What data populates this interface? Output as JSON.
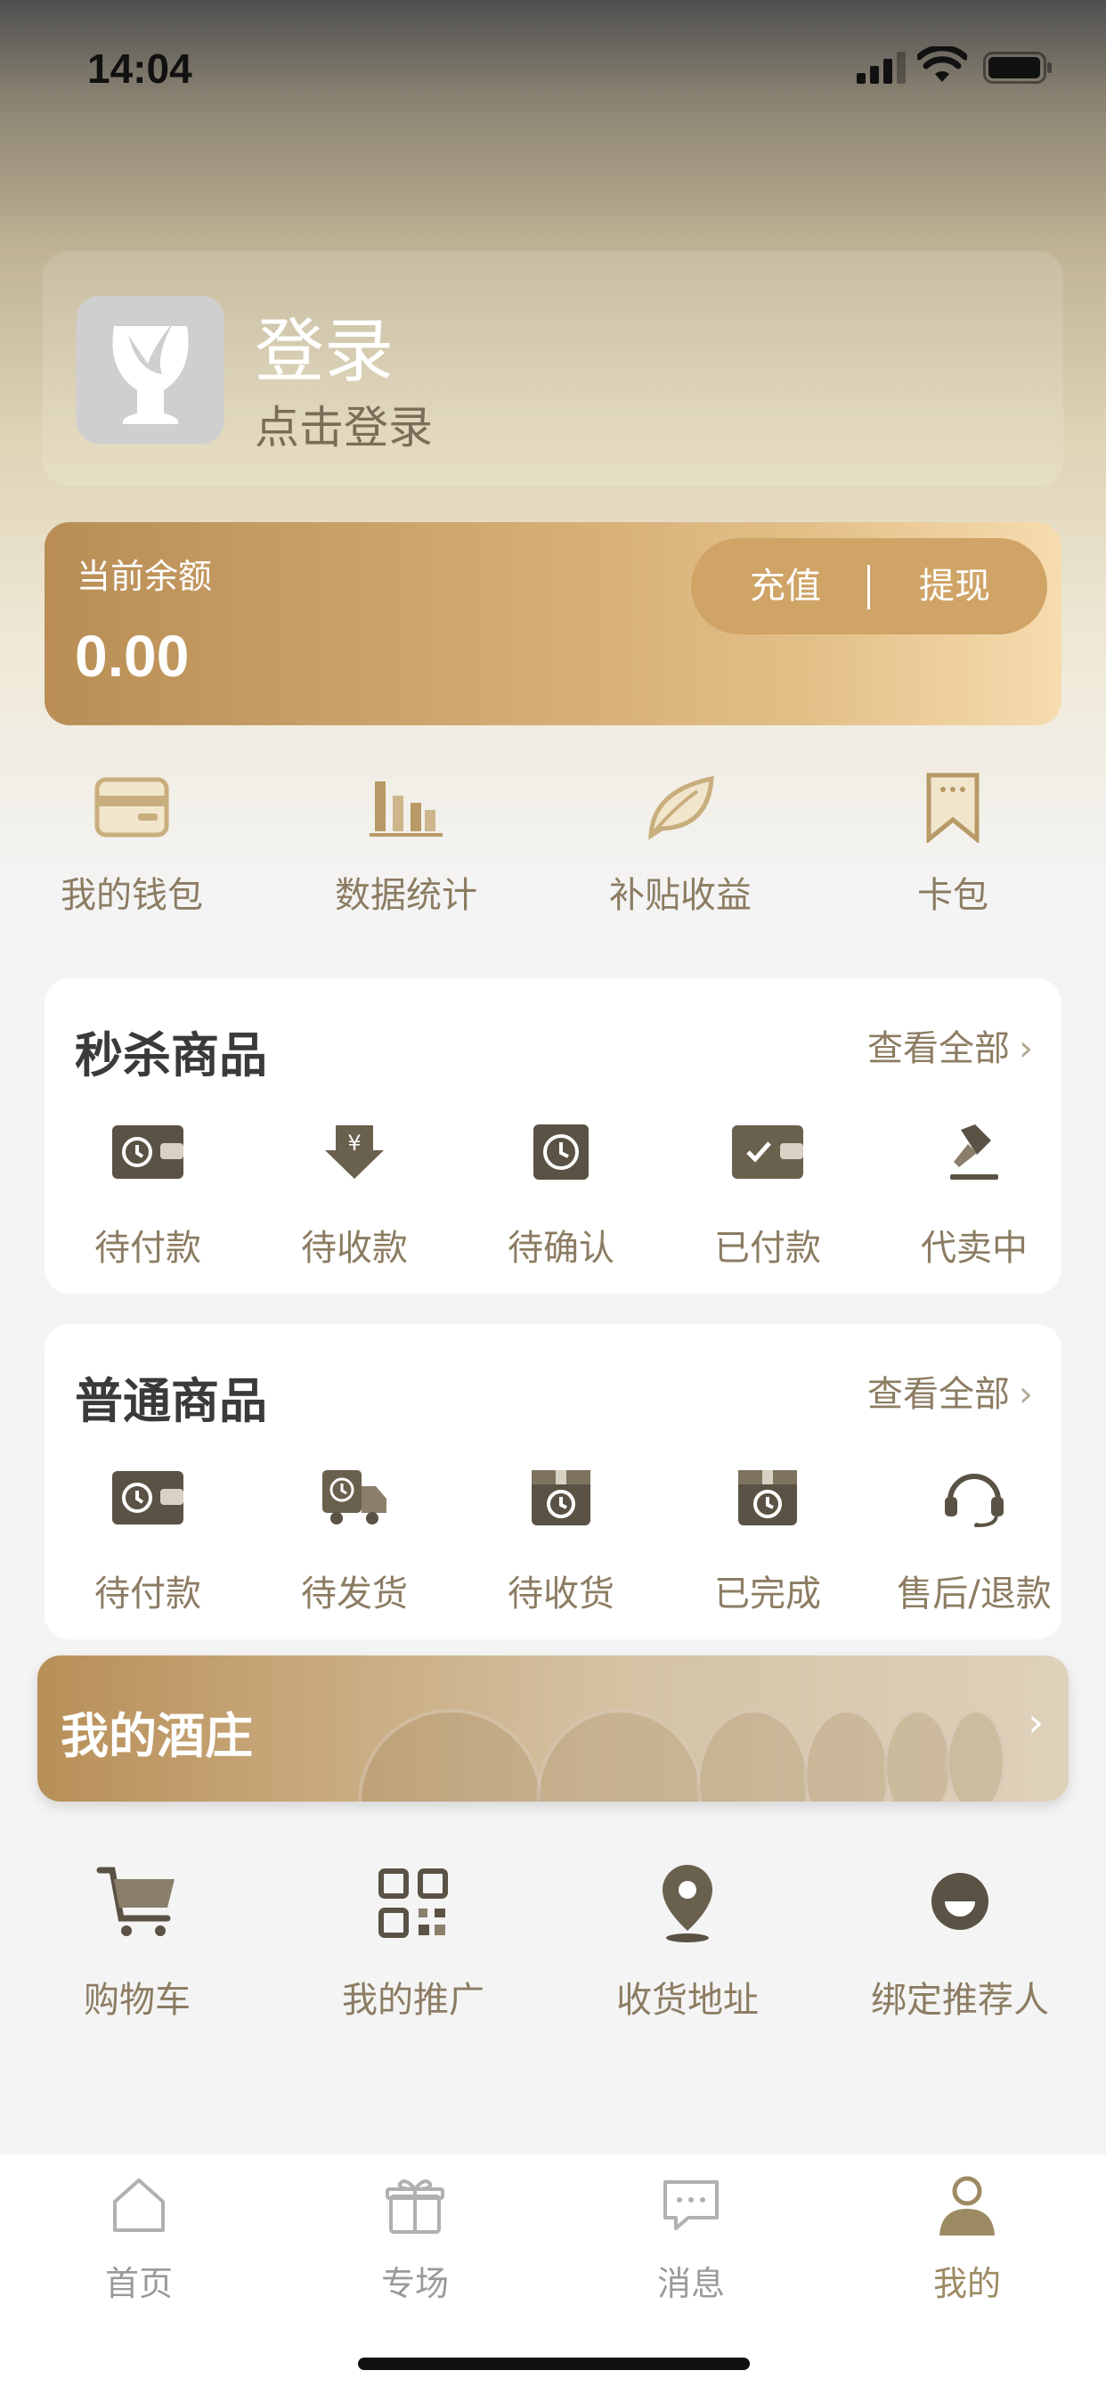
{
  "status_bar": {
    "time": "14:04"
  },
  "login": {
    "title": "登录",
    "subtitle": "点击登录"
  },
  "balance": {
    "label": "当前余额",
    "value": "0.00",
    "recharge": "充值",
    "withdraw": "提现"
  },
  "quick_links": [
    {
      "label": "我的钱包",
      "icon": "wallet-icon"
    },
    {
      "label": "数据统计",
      "icon": "bar-chart-icon"
    },
    {
      "label": "补贴收益",
      "icon": "leaf-icon"
    },
    {
      "label": "卡包",
      "icon": "card-bookmark-icon"
    }
  ],
  "flash_sale": {
    "title": "秒杀商品",
    "view_all": "查看全部",
    "items": [
      {
        "label": "待付款",
        "icon": "wallet-clock-icon"
      },
      {
        "label": "待收款",
        "icon": "yuan-arrow-icon"
      },
      {
        "label": "待确认",
        "icon": "clock-icon"
      },
      {
        "label": "已付款",
        "icon": "wallet-check-icon"
      },
      {
        "label": "代卖中",
        "icon": "auction-hammer-icon"
      }
    ]
  },
  "normal_goods": {
    "title": "普通商品",
    "view_all": "查看全部",
    "items": [
      {
        "label": "待付款",
        "icon": "wallet-clock-icon"
      },
      {
        "label": "待发货",
        "icon": "truck-icon"
      },
      {
        "label": "待收货",
        "icon": "box-clock-icon"
      },
      {
        "label": "已完成",
        "icon": "box-done-icon"
      },
      {
        "label": "售后/退款",
        "icon": "headset-icon"
      }
    ]
  },
  "winery_banner": {
    "title": "我的酒庄"
  },
  "tools": [
    {
      "label": "购物车",
      "icon": "cart-icon"
    },
    {
      "label": "我的推广",
      "icon": "qrcode-icon"
    },
    {
      "label": "收货地址",
      "icon": "location-pin-icon"
    },
    {
      "label": "绑定推荐人",
      "icon": "user-bind-icon"
    }
  ],
  "tab_bar": [
    {
      "label": "首页",
      "icon": "home-icon",
      "active": false
    },
    {
      "label": "专场",
      "icon": "gift-icon",
      "active": false
    },
    {
      "label": "消息",
      "icon": "message-icon",
      "active": false
    },
    {
      "label": "我的",
      "icon": "profile-icon",
      "active": true
    }
  ],
  "colors": {
    "accent": "#8c7c62",
    "card_gold": "#d2aa72",
    "icon_dark": "#5a5244"
  }
}
